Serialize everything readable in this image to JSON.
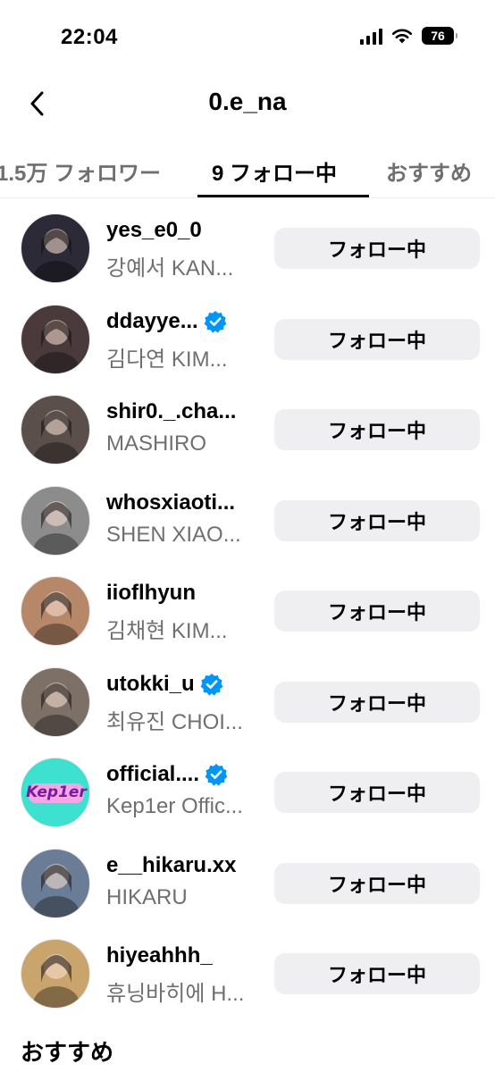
{
  "status": {
    "time": "22:04",
    "battery": "76"
  },
  "header": {
    "title": "0.e_na",
    "back_icon": "chevron-left-icon"
  },
  "tabs": [
    {
      "label": "1.5万 フォロワー"
    },
    {
      "label": "9 フォロー中"
    },
    {
      "label": "おすすめ"
    }
  ],
  "active_tab": 1,
  "following": [
    {
      "username": "yes_e0_0",
      "name": "강예서 KAN...",
      "verified": false,
      "avatar_color": "#2b2a36",
      "button": "フォロー中"
    },
    {
      "username": "ddayye...",
      "name": "김다연 KIM...",
      "verified": true,
      "avatar_color": "#4a3a3c",
      "button": "フォロー中"
    },
    {
      "username": "shir0._.cha...",
      "name": "MASHIRO",
      "verified": false,
      "avatar_color": "#5a4f4a",
      "button": "フォロー中"
    },
    {
      "username": "whosxiaoti...",
      "name": "SHEN XIAO...",
      "verified": false,
      "avatar_color": "#8c8c8c",
      "button": "フォロー中"
    },
    {
      "username": "iioflhyun",
      "name": "김채현 KIM...",
      "verified": false,
      "avatar_color": "#b7876a",
      "button": "フォロー中"
    },
    {
      "username": "utokki_u",
      "name": "최유진 CHOI...",
      "verified": true,
      "avatar_color": "#7d7067",
      "button": "フォロー中"
    },
    {
      "username": "official....",
      "name": "Kep1er Offic...",
      "verified": true,
      "avatar_color": "#3ee0d0",
      "logo_text": "Kep1er",
      "button": "フォロー中"
    },
    {
      "username": "e__hikaru.xx",
      "name": "HIKARU",
      "verified": false,
      "avatar_color": "#6b7d96",
      "button": "フォロー中"
    },
    {
      "username": "hiyeahhh_",
      "name": "휴닝바히에 H...",
      "verified": false,
      "avatar_color": "#c9a46c",
      "button": "フォロー中"
    }
  ],
  "suggested_title": "おすすめ",
  "colors": {
    "verified": "#0095f6",
    "button_bg": "#efeff2",
    "secondary_text": "#6f6f6f"
  }
}
